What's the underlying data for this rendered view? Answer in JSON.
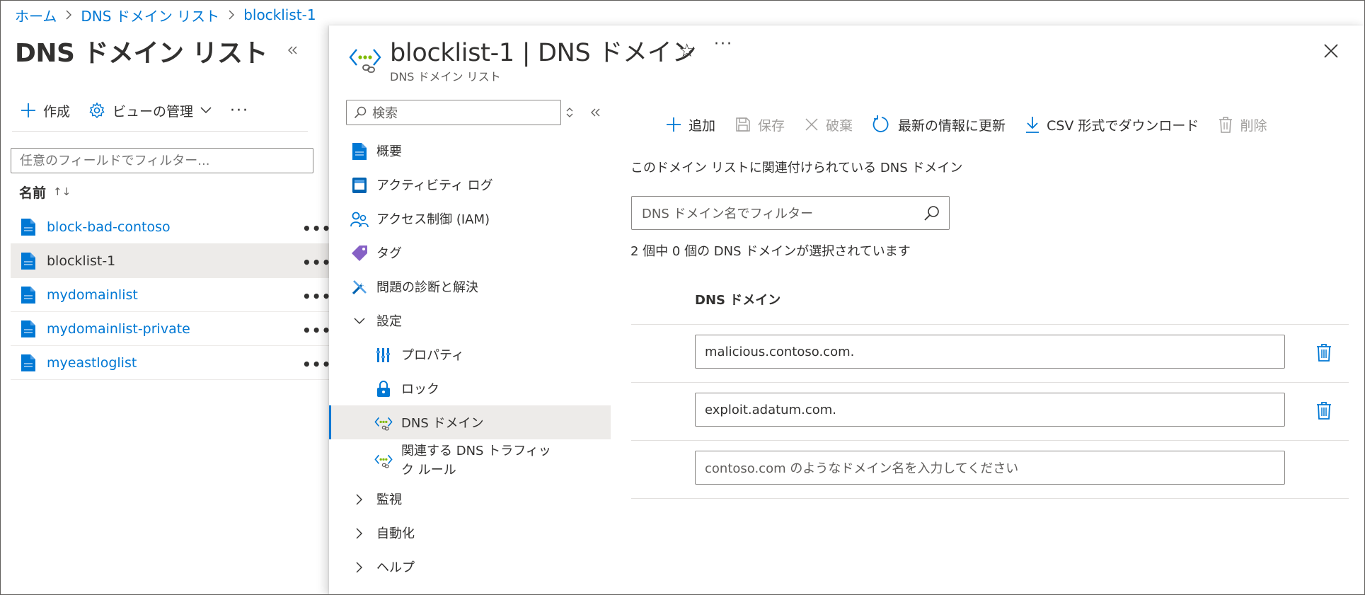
{
  "breadcrumb": [
    "ホーム",
    "DNS ドメイン リスト",
    "blocklist-1"
  ],
  "left_pane": {
    "title": "DNS ドメイン リスト",
    "commands": {
      "create": "作成",
      "manage_view": "ビューの管理",
      "more": "···"
    },
    "filter_placeholder": "任意のフィールドでフィルター...",
    "column_name": "名前",
    "sort_indicator": "↑↓",
    "items": [
      {
        "name": "block-bad-contoso",
        "more": "•••"
      },
      {
        "name": "blocklist-1",
        "more": "•••"
      },
      {
        "name": "mydomainlist",
        "more": "•••"
      },
      {
        "name": "mydomainlist-private",
        "more": "•••"
      },
      {
        "name": "myeastloglist",
        "more": "•••"
      }
    ],
    "selected_item": "blocklist-1"
  },
  "blade": {
    "title": "blocklist-1 | DNS ドメイン",
    "subtitle": "DNS ドメイン リスト",
    "star": "☆",
    "more": "···",
    "nav_search_placeholder": "検索",
    "nav": [
      {
        "label": "概要",
        "icon": "overview-icon"
      },
      {
        "label": "アクティビティ ログ",
        "icon": "activity-log-icon"
      },
      {
        "label": "アクセス制御 (IAM)",
        "icon": "iam-icon"
      },
      {
        "label": "タグ",
        "icon": "tag-icon"
      },
      {
        "label": "問題の診断と解決",
        "icon": "diagnose-icon"
      },
      {
        "label": "設定",
        "icon": "chevron-down-icon"
      },
      {
        "label": "プロパティ",
        "icon": "properties-icon"
      },
      {
        "label": "ロック",
        "icon": "lock-icon"
      },
      {
        "label": "DNS ドメイン",
        "icon": "dns-domain-icon"
      },
      {
        "label": "関連する DNS トラフィック ルール",
        "icon": "dns-rule-icon"
      },
      {
        "label": "監視",
        "icon": "chevron-right-icon"
      },
      {
        "label": "自動化",
        "icon": "chevron-right-icon"
      },
      {
        "label": "ヘルプ",
        "icon": "chevron-right-icon"
      }
    ],
    "selected_nav": "DNS ドメイン"
  },
  "content": {
    "commands": {
      "add": "追加",
      "save": "保存",
      "discard": "破棄",
      "refresh": "最新の情報に更新",
      "download": "CSV 形式でダウンロード",
      "delete": "削除"
    },
    "description": "このドメイン リストに関連付けられている DNS ドメイン",
    "filter_placeholder": "DNS ドメイン名でフィルター",
    "selection_count": "2 個中 0 個の DNS ドメインが選択されています",
    "column_header": "DNS ドメイン",
    "domains": [
      "malicious.contoso.com.",
      "exploit.adatum.com."
    ],
    "new_domain_placeholder": "contoso.com のようなドメイン名を入力してください"
  },
  "colors": {
    "accent": "#0078d4",
    "selected_bg": "#edebe9",
    "disabled": "#a19f9d",
    "border": "#8a8886"
  }
}
